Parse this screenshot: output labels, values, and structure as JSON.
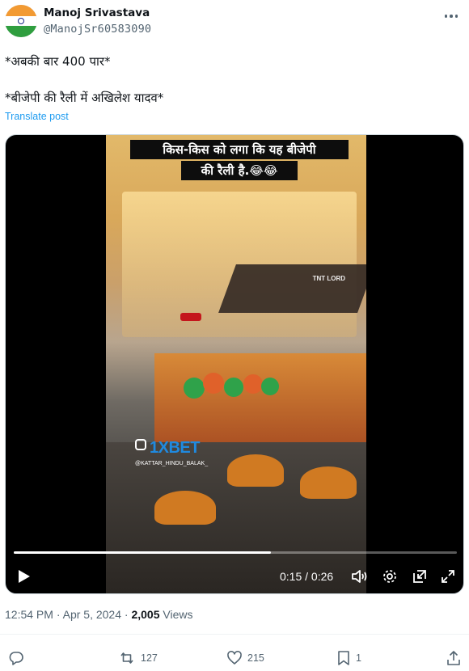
{
  "author": {
    "name": "Manoj Srivastava",
    "handle": "@ManojSr60583090",
    "avatar_icon": "indian-flag-avatar"
  },
  "tweet": {
    "line1": "*अबकी बार 400 पार*",
    "line2": "*बीजेपी की रैली में अखिलेश यादव*",
    "translate_label": "Translate post"
  },
  "video": {
    "caption_line1": "किस-किस को लगा कि यह बीजेपी",
    "caption_line2": "की रैली है.😂😂",
    "watermark": "TNT LORD",
    "sponsor_text": "1XBET",
    "sponsor_handle": "@KATTAR_HINDU_BALAK_",
    "time_current": "0:15",
    "time_total": "0:26",
    "time_display": "0:15 / 0:26",
    "progress": 0.58
  },
  "meta": {
    "time": "12:54 PM",
    "date": "Apr 5, 2024",
    "views_count": "2,005",
    "views_label": "Views"
  },
  "actions": {
    "replies": "",
    "reposts": "127",
    "likes": "215",
    "bookmarks": "1"
  },
  "colors": {
    "accent": "#1d9bf0",
    "text": "#0f1419",
    "muted": "#536471"
  }
}
